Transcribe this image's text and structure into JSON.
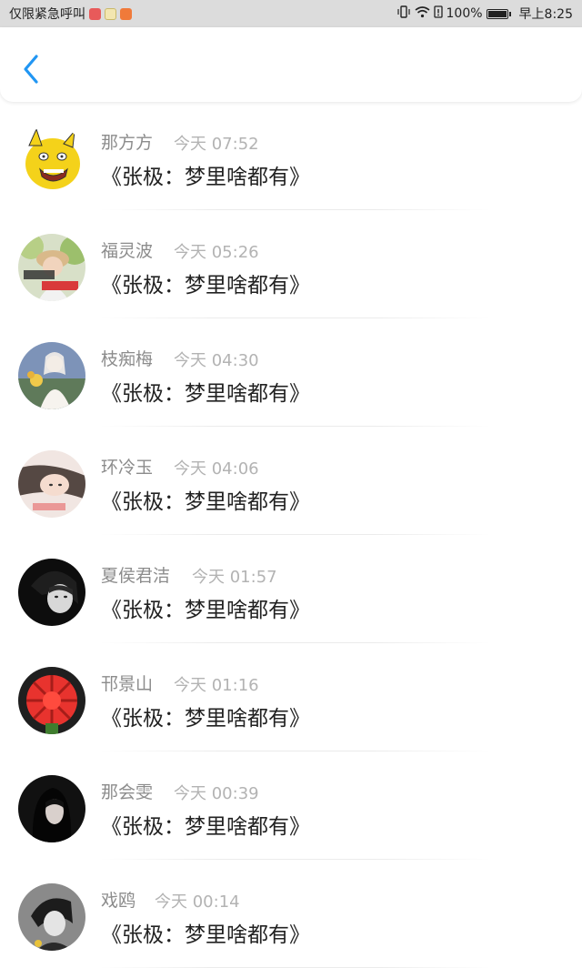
{
  "status_bar": {
    "carrier": "仅限紧急呼叫",
    "battery": "100%",
    "time": "早上8:25"
  },
  "header": {
    "back_icon": "chevron-left-icon",
    "accent_color": "#2196f3"
  },
  "messages": [
    {
      "name": "那方方",
      "time": "今天 07:52",
      "text": "《张极：梦里啥都有》"
    },
    {
      "name": "福灵波",
      "time": "今天 05:26",
      "text": "《张极：梦里啥都有》"
    },
    {
      "name": "枝痴梅",
      "time": "今天 04:30",
      "text": "《张极：梦里啥都有》"
    },
    {
      "name": "环冷玉",
      "time": "今天 04:06",
      "text": "《张极：梦里啥都有》"
    },
    {
      "name": "夏侯君洁",
      "time": "今天 01:57",
      "text": "《张极：梦里啥都有》"
    },
    {
      "name": "邗景山",
      "time": "今天 01:16",
      "text": "《张极：梦里啥都有》"
    },
    {
      "name": "那会雯",
      "time": "今天 00:39",
      "text": "《张极：梦里啥都有》"
    },
    {
      "name": "戏鸥",
      "time": "今天 00:14",
      "text": "《张极：梦里啥都有》"
    }
  ]
}
